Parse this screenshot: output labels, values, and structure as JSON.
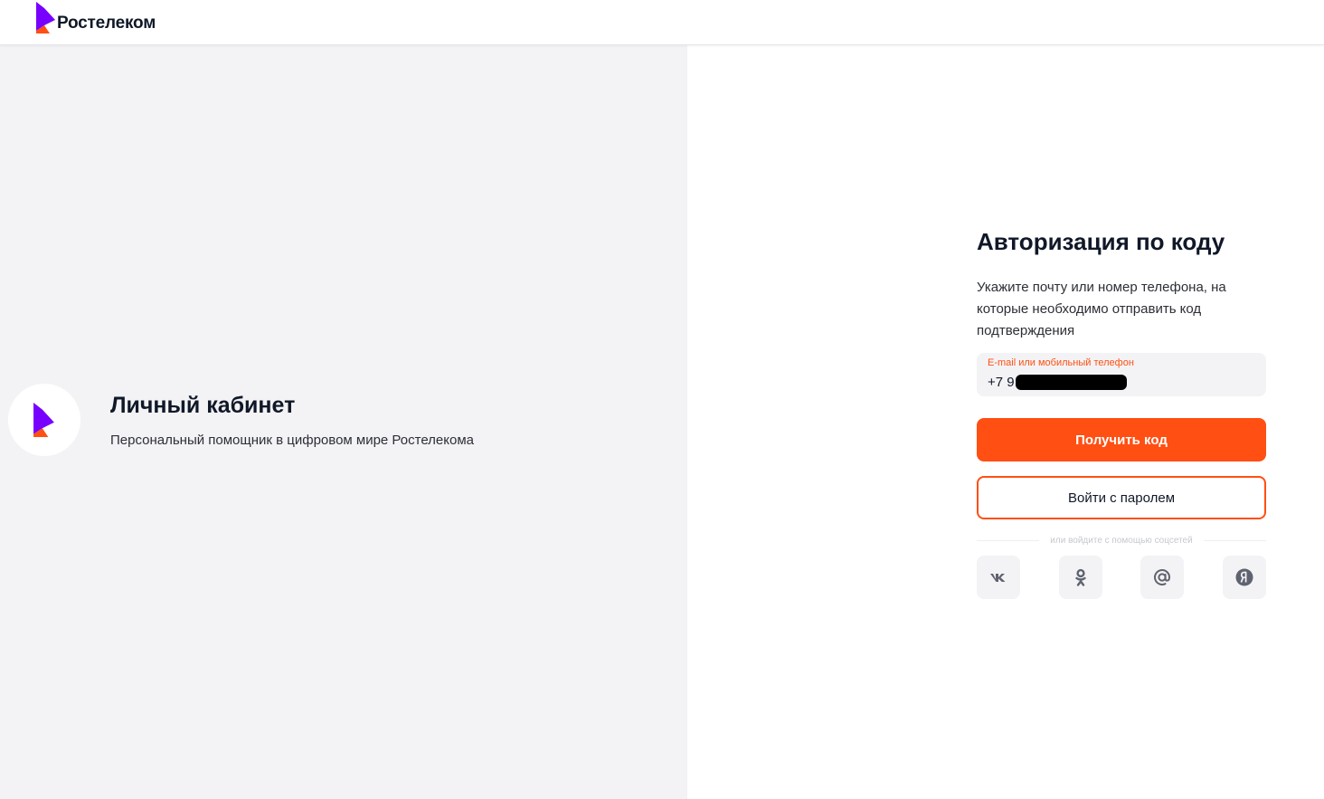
{
  "header": {
    "brand_name": "Ростелеком",
    "colors": {
      "logo_purple": "#7700ff",
      "logo_orange": "#ff4f12"
    }
  },
  "left": {
    "badge_icon": "rostelecom-logo-icon",
    "title": "Личный кабинет",
    "subtitle": "Персональный помощник в цифровом мире Ростелекома"
  },
  "auth": {
    "title": "Авторизация по коду",
    "description": "Укажите почту или номер телефона, на которые необходимо отправить код подтверждения",
    "field": {
      "label": "E-mail или мобильный телефон",
      "value": "+7 9",
      "redacted": true
    },
    "primary_button": "Получить код",
    "secondary_button": "Войти с паролем",
    "divider_text": "или войдите с помощью соцсетей",
    "socials": [
      {
        "name": "vk",
        "icon": "vk-icon"
      },
      {
        "name": "odnoklassniki",
        "icon": "odnoklassniki-icon"
      },
      {
        "name": "mail-ru",
        "icon": "at-sign-icon"
      },
      {
        "name": "yandex",
        "icon": "yandex-icon"
      }
    ],
    "colors": {
      "accent": "#ff4f12",
      "field_background": "#f3f3f5",
      "social_icon": "#5f6370"
    }
  }
}
